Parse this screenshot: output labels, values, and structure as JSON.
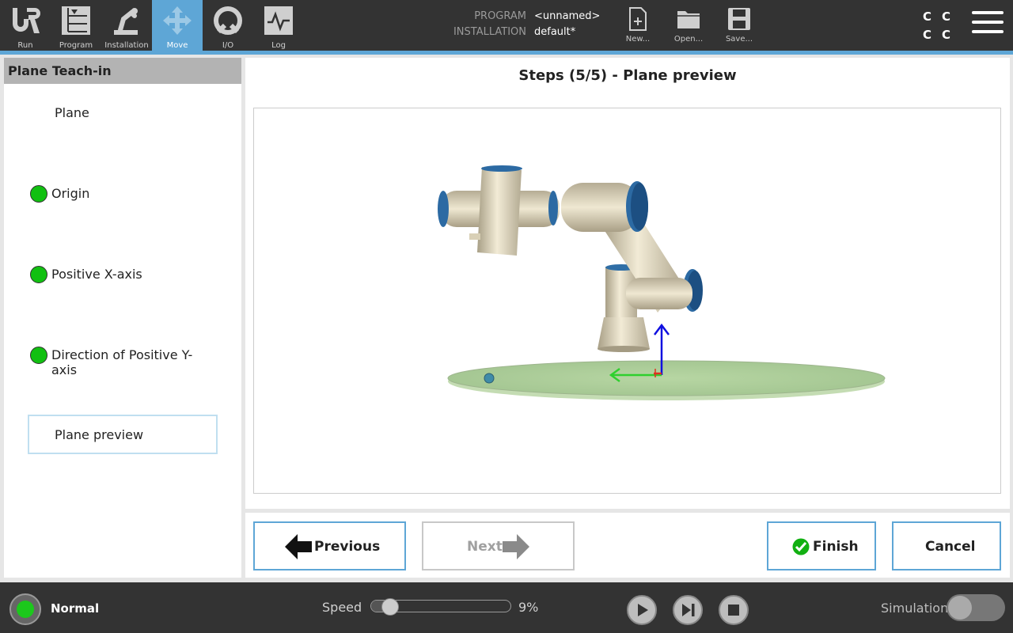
{
  "nav": {
    "items": [
      {
        "label": "Run",
        "icon": "ur-logo-icon"
      },
      {
        "label": "Program",
        "icon": "program-icon"
      },
      {
        "label": "Installation",
        "icon": "installation-icon"
      },
      {
        "label": "Move",
        "icon": "move-icon"
      },
      {
        "label": "I/O",
        "icon": "io-icon"
      },
      {
        "label": "Log",
        "icon": "log-icon"
      }
    ],
    "active": "Move"
  },
  "header": {
    "program_label": "PROGRAM",
    "program_value": "<unnamed>",
    "installation_label": "INSTALLATION",
    "installation_value": "default*",
    "file_buttons": [
      {
        "label": "New...",
        "icon": "new-file-icon"
      },
      {
        "label": "Open...",
        "icon": "open-folder-icon"
      },
      {
        "label": "Save...",
        "icon": "save-disk-icon"
      }
    ],
    "cc": [
      "C",
      "C",
      "C",
      "C"
    ]
  },
  "sidebar": {
    "title": "Plane Teach-in",
    "steps": [
      {
        "label": "Plane",
        "status": "none"
      },
      {
        "label": "Origin",
        "status": "done"
      },
      {
        "label": "Positive X-axis",
        "status": "done"
      },
      {
        "label": "Direction of Positive Y-axis",
        "status": "done"
      },
      {
        "label": "Plane preview",
        "status": "current"
      }
    ]
  },
  "main": {
    "title": "Steps (5/5) - Plane preview"
  },
  "actions": {
    "previous": "Previous",
    "next": "Next",
    "finish": "Finish",
    "cancel": "Cancel"
  },
  "footer": {
    "status": "Normal",
    "speed_label": "Speed",
    "speed_value": "9%",
    "speed_fraction": 0.09,
    "simulation_label": "Simulation",
    "simulation_on": false
  },
  "colors": {
    "accent": "#5ea6d6",
    "status_ok": "#1cc81c",
    "bar_bg": "#333333"
  }
}
